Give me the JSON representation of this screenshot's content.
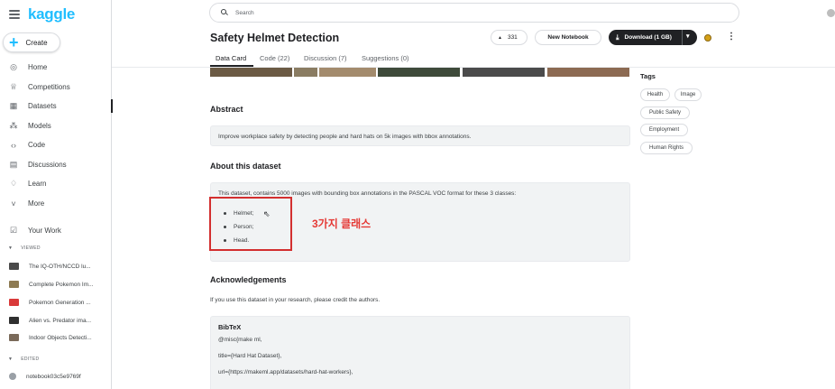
{
  "brand": {
    "logo_text": "kaggle",
    "accent": "#20beff"
  },
  "sidebar": {
    "create_label": "Create",
    "items": [
      {
        "label": "Home",
        "icon": "home-icon"
      },
      {
        "label": "Competitions",
        "icon": "trophy-icon"
      },
      {
        "label": "Datasets",
        "icon": "table-icon",
        "active": true
      },
      {
        "label": "Models",
        "icon": "models-icon"
      },
      {
        "label": "Code",
        "icon": "code-icon"
      },
      {
        "label": "Discussions",
        "icon": "discussions-icon"
      },
      {
        "label": "Learn",
        "icon": "learn-icon"
      },
      {
        "label": "More",
        "icon": "chevron-down-icon"
      }
    ],
    "your_work": "Your Work",
    "viewed_label": "VIEWED",
    "viewed": [
      "The IQ-OTH/NCCD lu...",
      "Complete Pokemon Im...",
      "Pokemon Generation ...",
      "Alien vs. Predator ima...",
      "Indoor Objects Detecti..."
    ],
    "edited_label": "EDITED",
    "edited": [
      "notebook03c5e9769f"
    ]
  },
  "search": {
    "placeholder": "Search"
  },
  "header": {
    "title": "Safety Helmet Detection",
    "vote_count": "331",
    "new_notebook": "New Notebook",
    "download": "Download (1 GB)"
  },
  "tabs": [
    "Data Card",
    "Code (22)",
    "Discussion (7)",
    "Suggestions (0)"
  ],
  "content": {
    "abstract_heading": "Abstract",
    "abstract_text": "Improve workplace safety by detecting people and hard hats on 5k images with bbox annotations.",
    "about_heading": "About this dataset",
    "about_text": "This dataset, contains 5000 images with bounding box annotations in the PASCAL VOC format for these 3 classes:",
    "classes": [
      "Helmet;",
      "Person;",
      "Head."
    ],
    "annotation": "3가지 클래스",
    "ack_heading": "Acknowledgements",
    "ack_text": "If you use this dataset in your research, please credit the authors.",
    "bibtex_heading": "BibTeX",
    "bibtex_lines": [
      "@misc{make ml,",
      "title={Hard Hat Dataset},",
      "url={https://makeml.app/datasets/hard-hat-workers},"
    ]
  },
  "tags": {
    "heading": "Tags",
    "items": [
      "Health",
      "Image",
      "Public Safety",
      "Employment",
      "Human Rights"
    ]
  }
}
